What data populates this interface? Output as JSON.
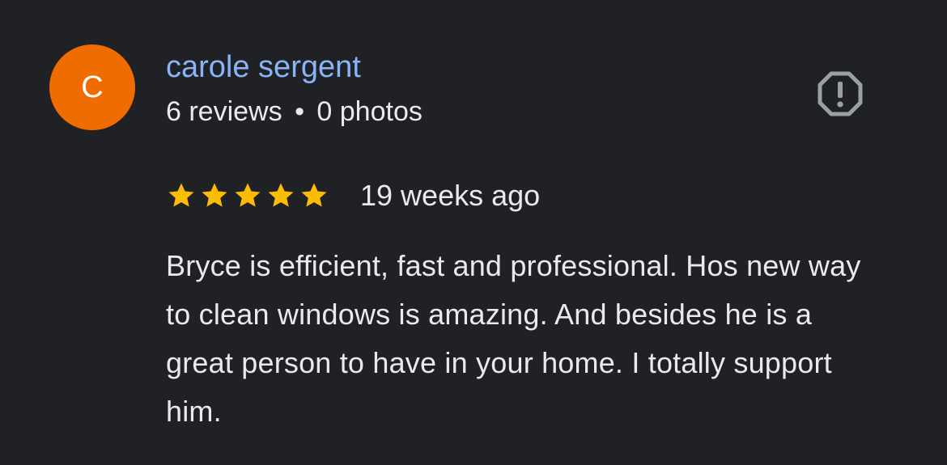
{
  "author": {
    "initial": "C",
    "name": "carole sergent",
    "reviews": "6 reviews",
    "separator": "•",
    "photos": "0 photos",
    "avatar_color": "#ef6c00"
  },
  "report": {
    "icon": "report-flag-icon"
  },
  "review": {
    "rating": 5,
    "max_rating": 5,
    "star_color": "#fbbc04",
    "date": "19 weeks ago",
    "text": "Bryce is efficient, fast and professional. Hos new way to clean windows is amazing. And besides he is a great person to have in your home. I totally support him."
  }
}
